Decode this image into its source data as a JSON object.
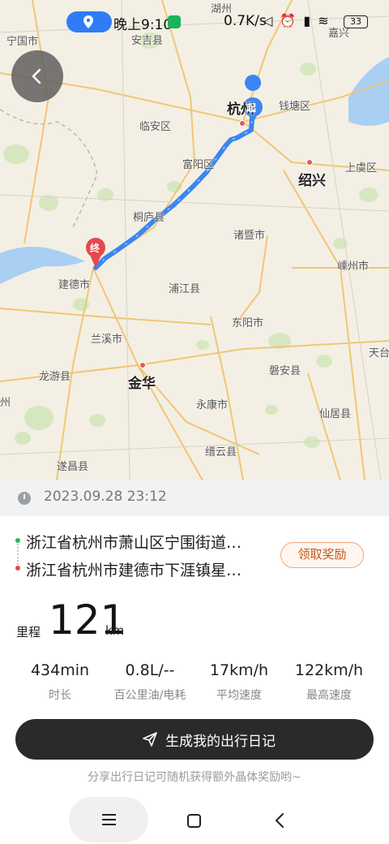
{
  "status_bar": {
    "time": "晚上9:10",
    "net_speed": "0.7K/s",
    "icons": "◁ ⏰ ▮ ≋",
    "battery": "33",
    "location_icon": "location-pin-icon",
    "wechat_icon": "wechat-icon"
  },
  "map": {
    "labels": {
      "ningguo": "宁国市",
      "anji": "安吉县",
      "lin_an": "临安区",
      "hangzhou": "杭州",
      "qiantang": "钱塘区",
      "fuyang": "富阳区",
      "shaoxing": "绍兴",
      "shangyu": "上虞区",
      "tonglu": "桐庐县",
      "zhuji": "诸暨市",
      "shengzhou": "嵊州市",
      "jiande": "建德市",
      "pujiang": "浦江县",
      "dongyang": "东阳市",
      "lanxi": "兰溪市",
      "tiantai": "天台",
      "longyou": "龙游县",
      "jinhua": "金华",
      "panan": "磐安县",
      "yongkang": "永康市",
      "xianju": "仙居县",
      "jinyun": "缙云县",
      "suichang": "遂昌县",
      "jiaxing_partial": "嘉兴",
      "huzhou_partial": "湖州",
      "quzhou_partial": "州"
    },
    "start_marker": "起",
    "end_marker": "终",
    "route_color": "#3a86f0"
  },
  "trip": {
    "datetime": "2023.09.28 23:12",
    "from": "浙江省杭州市萧山区宁围街道…",
    "to": "浙江省杭州市建德市下涯镇星…",
    "reward_label": "领取奖励",
    "distance_label": "里程",
    "distance_value": "121",
    "distance_unit": "km",
    "stats": [
      {
        "value": "434min",
        "label": "时长"
      },
      {
        "value": "0.8L/--",
        "label": "百公里油/电耗"
      },
      {
        "value": "17km/h",
        "label": "平均速度"
      },
      {
        "value": "122km/h",
        "label": "最高速度"
      }
    ],
    "diary_button": "生成我的出行日记",
    "share_tip": "分享出行日记可随机获得额外晶体奖励哟~"
  },
  "colors": {
    "route": "#3a86f0",
    "button_dark": "#2a2a2a",
    "reward_text": "#c2581f"
  }
}
